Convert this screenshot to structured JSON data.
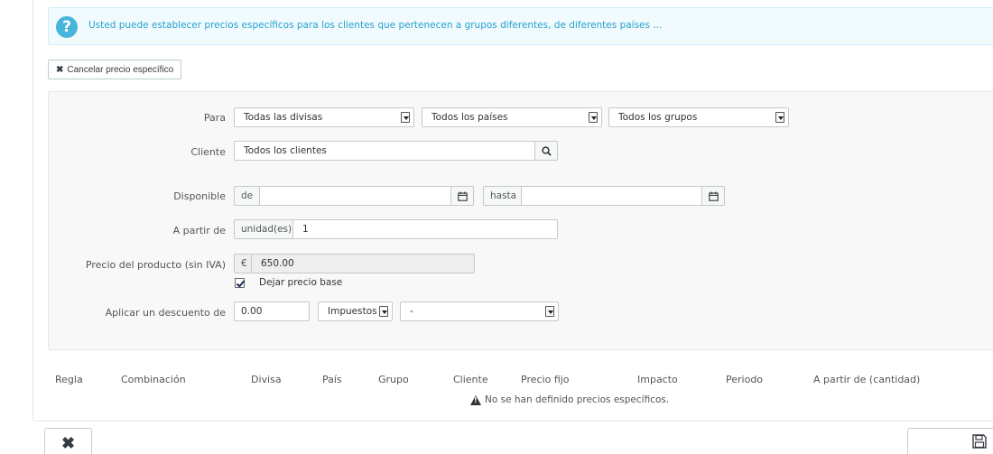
{
  "alert": {
    "text": "Usted puede establecer precios específicos para los clientes que pertenecen a grupos diferentes, de diferentes países ..."
  },
  "cancel_button": {
    "label": "Cancelar precio específico"
  },
  "form": {
    "para_label": "Para",
    "currency_select": "Todas las divisas",
    "country_select": "Todos los países",
    "group_select": "Todos los grupos",
    "cliente_label": "Cliente",
    "cliente_value": "Todos los clientes",
    "disponible_label": "Disponible",
    "from_addon": "de",
    "from_value": "",
    "to_addon": "hasta",
    "to_value": "",
    "apartir_label": "A partir de",
    "unit_addon": "unidad(es)",
    "unit_value": "1",
    "precio_label": "Precio del producto (sin IVA)",
    "currency_symbol": "€",
    "price_value": "650.00",
    "keep_base_label": "Dejar precio base",
    "keep_base_checked": true,
    "descuento_label": "Aplicar un descuento de",
    "discount_value": "0.00",
    "tax_select": "Impuestos",
    "type_select": "-"
  },
  "table": {
    "headers": [
      "Regla",
      "Combinación",
      "Divisa",
      "País",
      "Grupo",
      "Cliente",
      "Precio fijo",
      "Impacto",
      "Periodo",
      "A partir de (cantidad)"
    ],
    "empty_message": "No se han definido precios específicos."
  },
  "colors": {
    "accent": "#25a1cf",
    "info_icon": "#48b5dd"
  }
}
